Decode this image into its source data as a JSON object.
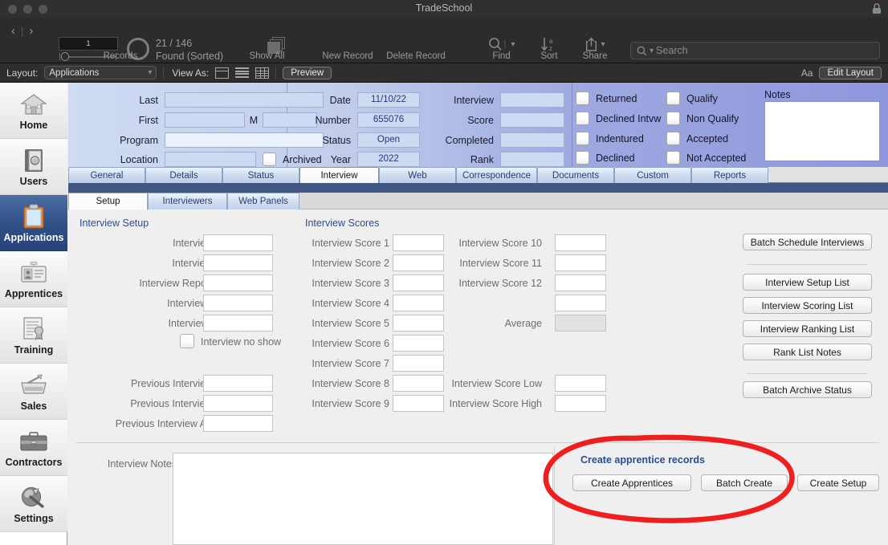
{
  "window": {
    "title": "TradeSchool",
    "lock_icon": "lock-icon"
  },
  "toolbar": {
    "prev_icon": "chevron-left-icon",
    "next_icon": "chevron-right-icon",
    "record_number": "1",
    "found_count": "21 / 146",
    "found_status": "Found (Sorted)",
    "records_label": "Records",
    "show_all_label": "Show All",
    "new_record_label": "New Record",
    "delete_record_label": "Delete Record",
    "find_label": "Find",
    "sort_label": "Sort",
    "share_label": "Share",
    "search_placeholder": "Search",
    "search_value": ""
  },
  "layout_bar": {
    "layout_label": "Layout:",
    "layout_value": "Applications",
    "view_as_label": "View As:",
    "preview_label": "Preview",
    "text_tool": "Aa",
    "edit_layout_label": "Edit Layout"
  },
  "sidebar": {
    "items": [
      {
        "label": "Home",
        "icon": "home-icon",
        "active": false
      },
      {
        "label": "Users",
        "icon": "address-book-icon",
        "active": false
      },
      {
        "label": "Applications",
        "icon": "clipboard-icon",
        "active": true
      },
      {
        "label": "Apprentices",
        "icon": "id-card-icon",
        "active": false
      },
      {
        "label": "Training",
        "icon": "certificate-icon",
        "active": false
      },
      {
        "label": "Sales",
        "icon": "shopping-basket-icon",
        "active": false
      },
      {
        "label": "Contractors",
        "icon": "briefcase-icon",
        "active": false
      },
      {
        "label": "Settings",
        "icon": "wrench-icon",
        "active": false
      }
    ]
  },
  "header_form": {
    "left_fields": [
      {
        "label": "Last",
        "value": ""
      },
      {
        "label": "First",
        "value": ""
      },
      {
        "label": "M",
        "value": ""
      },
      {
        "label": "Program",
        "value": ""
      },
      {
        "label": "Location",
        "value": ""
      }
    ],
    "archived_label": "Archived",
    "archived_checked": false,
    "mid_fields": [
      {
        "label": "Date",
        "value": "11/10/22"
      },
      {
        "label": "Number",
        "value": "655076"
      },
      {
        "label": "Status",
        "value": "Open"
      },
      {
        "label": "Year",
        "value": "2022"
      }
    ],
    "mid2_fields": [
      {
        "label": "Interview",
        "value": ""
      },
      {
        "label": "Score",
        "value": ""
      },
      {
        "label": "Completed",
        "value": ""
      },
      {
        "label": "Rank",
        "value": ""
      }
    ],
    "checks_col1": [
      {
        "label": "Returned",
        "checked": false
      },
      {
        "label": "Declined Intvw",
        "checked": false
      },
      {
        "label": "Indentured",
        "checked": false
      },
      {
        "label": "Declined",
        "checked": false
      }
    ],
    "checks_col2": [
      {
        "label": "Qualify",
        "checked": false
      },
      {
        "label": "Non Qualify",
        "checked": false
      },
      {
        "label": "Accepted",
        "checked": false
      },
      {
        "label": "Not Accepted",
        "checked": false
      }
    ],
    "notes_label": "Notes",
    "notes_value": ""
  },
  "tabs": {
    "primary": [
      {
        "label": "General",
        "active": false
      },
      {
        "label": "Details",
        "active": false
      },
      {
        "label": "Status",
        "active": false
      },
      {
        "label": "Interview",
        "active": true
      },
      {
        "label": "Web",
        "active": false
      },
      {
        "label": "Correspondence",
        "active": false
      },
      {
        "label": "Documents",
        "active": false
      },
      {
        "label": "Custom",
        "active": false
      },
      {
        "label": "Reports",
        "active": false
      }
    ],
    "secondary": [
      {
        "label": "Setup",
        "active": true
      },
      {
        "label": "Interviewers",
        "active": false
      },
      {
        "label": "Web Panels",
        "active": false
      }
    ]
  },
  "interview_setup": {
    "section_title": "Interview Setup",
    "fields": [
      {
        "label": "Interview Date",
        "value": ""
      },
      {
        "label": "Interview Time",
        "value": ""
      },
      {
        "label": "Interview Report Time",
        "value": ""
      },
      {
        "label": "Interview Room",
        "value": ""
      },
      {
        "label": "Interview Order",
        "value": ""
      }
    ],
    "no_show_label": "Interview no show",
    "no_show_checked": false,
    "previous_fields": [
      {
        "label": "Previous Interview Date",
        "value": ""
      },
      {
        "label": "Previous Interview Time",
        "value": ""
      },
      {
        "label": "Previous Interview Average",
        "value": ""
      }
    ]
  },
  "interview_scores": {
    "section_title": "Interview Scores",
    "col1": [
      {
        "label": "Interview Score 1",
        "value": ""
      },
      {
        "label": "Interview Score 2",
        "value": ""
      },
      {
        "label": "Interview Score 3",
        "value": ""
      },
      {
        "label": "Interview Score 4",
        "value": ""
      },
      {
        "label": "Interview Score 5",
        "value": ""
      },
      {
        "label": "Interview Score 6",
        "value": ""
      },
      {
        "label": "Interview Score 7",
        "value": ""
      },
      {
        "label": "Interview Score 8",
        "value": ""
      },
      {
        "label": "Interview Score 9",
        "value": ""
      }
    ],
    "col2": [
      {
        "label": "Interview Score 10",
        "value": ""
      },
      {
        "label": "Interview Score 11",
        "value": ""
      },
      {
        "label": "Interview Score 12",
        "value": ""
      },
      {
        "label": "",
        "value": ""
      }
    ],
    "average_label": "Average",
    "average_value": "",
    "low_label": "Interview Score Low",
    "low_value": "",
    "high_label": "Interview Score High",
    "high_value": ""
  },
  "action_buttons": [
    {
      "label": "Batch Schedule Interviews"
    },
    {
      "label": "Interview Setup List"
    },
    {
      "label": "Interview Scoring List"
    },
    {
      "label": "Interview Ranking List"
    },
    {
      "label": "Rank List Notes"
    },
    {
      "label": "Batch Archive Status"
    }
  ],
  "interview_notes": {
    "label": "Interview Notes",
    "value": ""
  },
  "create_panel": {
    "title": "Create apprentice records",
    "buttons": [
      {
        "label": "Create Apprentices"
      },
      {
        "label": "Batch Create"
      },
      {
        "label": "Create Setup"
      }
    ]
  },
  "annotation": {
    "shape": "red-ellipse-highlight",
    "color": "#f01f1f"
  }
}
